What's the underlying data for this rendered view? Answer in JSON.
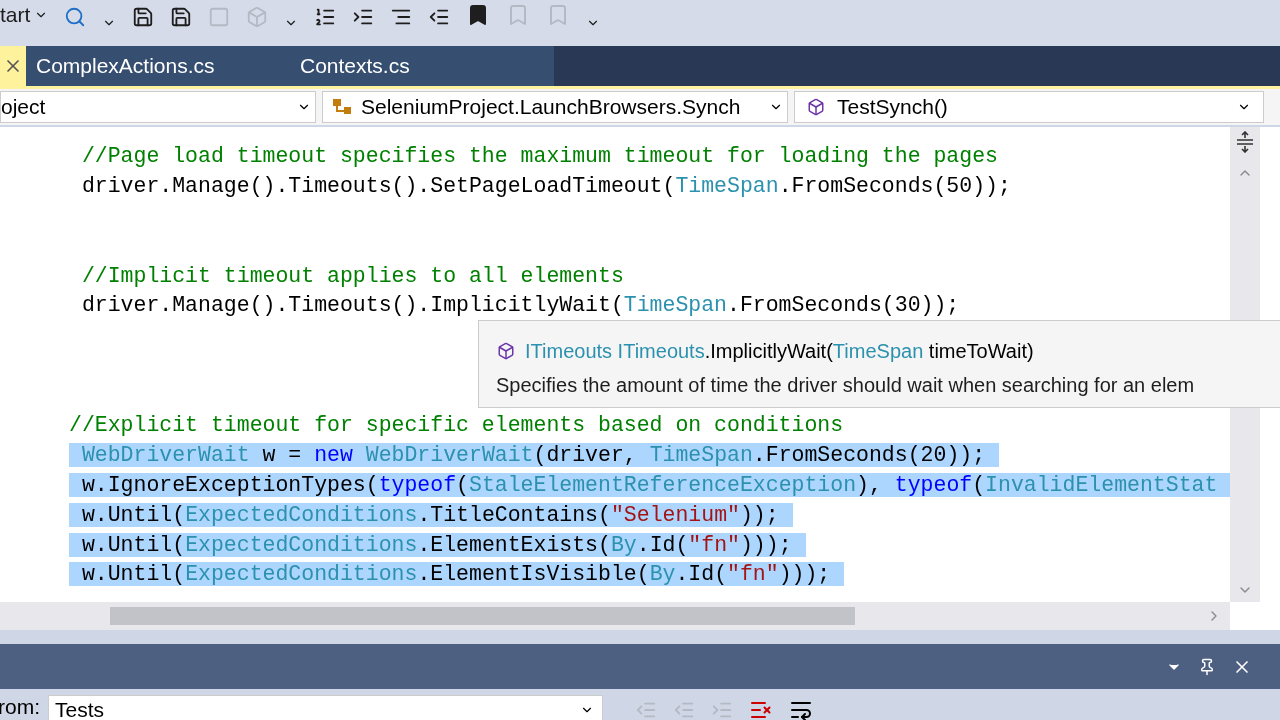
{
  "toolbar": {
    "start_label": "tart"
  },
  "tabs": [
    {
      "label": "ComplexActions.cs",
      "selected": false
    },
    {
      "label": "Contexts.cs",
      "selected": false
    }
  ],
  "active_tab": {
    "selected": true
  },
  "nav_bar": {
    "project": "oject",
    "class": "SeleniumProject.LaunchBrowsers.Synch",
    "member": "TestSynch()"
  },
  "code_lines": [
    {
      "kind": "code",
      "selected": false,
      "tokens": [
        {
          "kind": "comment",
          "text": " //Page load timeout specifies the maximum timeout for loading the pages"
        }
      ]
    },
    {
      "kind": "code",
      "selected": false,
      "tokens": [
        {
          "kind": "plain",
          "text": " driver.Manage().Timeouts().SetPageLoadTimeout("
        },
        {
          "kind": "type",
          "text": "TimeSpan"
        },
        {
          "kind": "plain",
          "text": ".FromSeconds(50));"
        }
      ]
    },
    {
      "kind": "blank"
    },
    {
      "kind": "blank"
    },
    {
      "kind": "code",
      "selected": false,
      "tokens": [
        {
          "kind": "comment",
          "text": " //Implicit timeout applies to all elements"
        }
      ]
    },
    {
      "kind": "code",
      "selected": false,
      "tokens": [
        {
          "kind": "plain",
          "text": " driver.Manage().Timeouts().ImplicitlyWait("
        },
        {
          "kind": "type",
          "text": "TimeSpan"
        },
        {
          "kind": "plain",
          "text": ".FromSeconds(30));"
        }
      ]
    },
    {
      "kind": "blank"
    },
    {
      "kind": "blank"
    },
    {
      "kind": "blank"
    },
    {
      "kind": "code",
      "selected": false,
      "tokens": [
        {
          "kind": "comment",
          "text": "//Explicit timeout for specific elements based on conditions"
        }
      ]
    },
    {
      "kind": "code",
      "selected": true,
      "tokens": [
        {
          "kind": "type",
          "text": " WebDriverWait"
        },
        {
          "kind": "plain",
          "text": " w = "
        },
        {
          "kind": "keyword",
          "text": "new "
        },
        {
          "kind": "type",
          "text": "WebDriverWait"
        },
        {
          "kind": "plain",
          "text": "(driver, "
        },
        {
          "kind": "type",
          "text": "TimeSpan"
        },
        {
          "kind": "plain",
          "text": ".FromSeconds(20));"
        }
      ]
    },
    {
      "kind": "code",
      "selected": true,
      "tokens": [
        {
          "kind": "plain",
          "text": " w.IgnoreExceptionTypes("
        },
        {
          "kind": "keyword",
          "text": "typeof"
        },
        {
          "kind": "plain",
          "text": "("
        },
        {
          "kind": "type",
          "text": "StaleElementReferenceException"
        },
        {
          "kind": "plain",
          "text": "), "
        },
        {
          "kind": "keyword",
          "text": "typeof"
        },
        {
          "kind": "plain",
          "text": "("
        },
        {
          "kind": "type",
          "text": "InvalidElementStat"
        }
      ]
    },
    {
      "kind": "code",
      "selected": true,
      "tokens": [
        {
          "kind": "plain",
          "text": " w.Until("
        },
        {
          "kind": "type",
          "text": "ExpectedConditions"
        },
        {
          "kind": "plain",
          "text": ".TitleContains("
        },
        {
          "kind": "string",
          "text": "\"Selenium\""
        },
        {
          "kind": "plain",
          "text": "));"
        }
      ]
    },
    {
      "kind": "code",
      "selected": true,
      "tokens": [
        {
          "kind": "plain",
          "text": " w.Until("
        },
        {
          "kind": "type",
          "text": "ExpectedConditions"
        },
        {
          "kind": "plain",
          "text": ".ElementExists("
        },
        {
          "kind": "type",
          "text": "By"
        },
        {
          "kind": "plain",
          "text": ".Id("
        },
        {
          "kind": "string",
          "text": "\"fn\""
        },
        {
          "kind": "plain",
          "text": ")));"
        }
      ]
    },
    {
      "kind": "code",
      "selected": true,
      "tokens": [
        {
          "kind": "plain",
          "text": " w.Until("
        },
        {
          "kind": "type",
          "text": "ExpectedConditions"
        },
        {
          "kind": "plain",
          "text": ".ElementIsVisible("
        },
        {
          "kind": "type",
          "text": "By"
        },
        {
          "kind": "plain",
          "text": ".Id("
        },
        {
          "kind": "string",
          "text": "\"fn\""
        },
        {
          "kind": "plain",
          "text": ")));"
        }
      ]
    }
  ],
  "tooltip": {
    "signature": [
      {
        "kind": "type",
        "text": "ITimeouts ITimeouts"
      },
      {
        "kind": "plain",
        "text": ".ImplicitlyWait("
      },
      {
        "kind": "type",
        "text": "TimeSpan"
      },
      {
        "kind": "plain",
        "text": " timeToWait)"
      }
    ],
    "description": "Specifies the amount of time the driver should wait when searching for an elem"
  },
  "bottom_panel": {
    "from_label": "rom:",
    "from_value": "Tests"
  }
}
